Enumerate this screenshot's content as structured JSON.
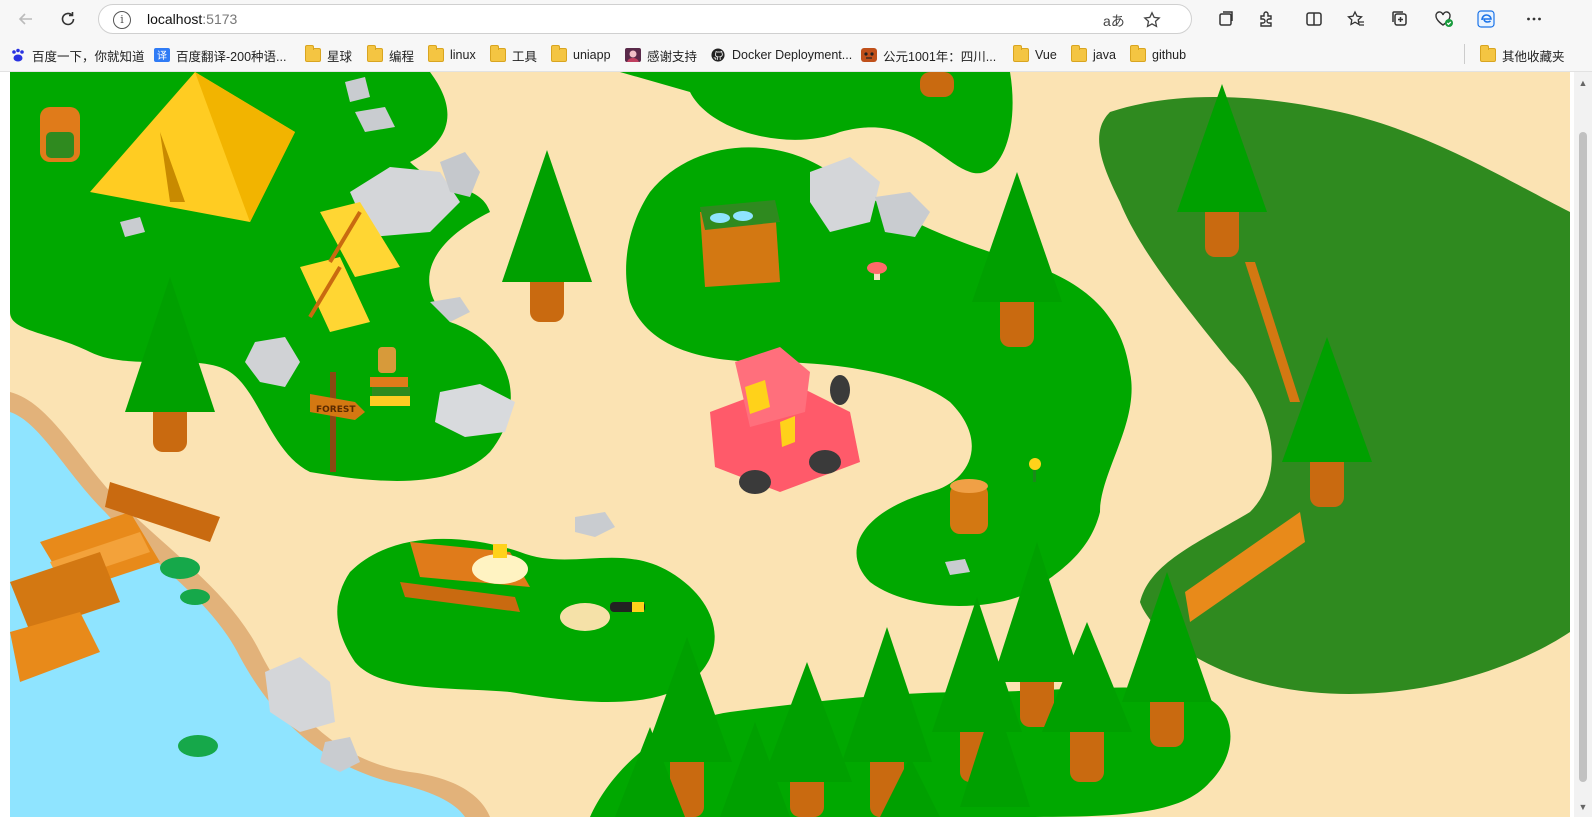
{
  "browser": {
    "nav": {
      "back_icon": "arrow-left-icon",
      "refresh_icon": "refresh-icon"
    },
    "address": {
      "host": "localhost",
      "port": ":5173"
    },
    "right_icons": [
      "read-aloud-icon",
      "favorite-star-icon",
      "tab-actions-icon",
      "extensions-icon",
      "split-screen-icon",
      "favorites-icon",
      "collections-icon",
      "browser-essentials-icon",
      "edge-icon",
      "more-icon"
    ],
    "addr_read_label": "aあ"
  },
  "bookmarks": [
    {
      "label": "百度一下，你就知道",
      "icon": "baidu-paw-icon"
    },
    {
      "label": "百度翻译-200种语...",
      "icon": "translate-icon"
    },
    {
      "label": "星球",
      "icon": "folder-icon"
    },
    {
      "label": "编程",
      "icon": "folder-icon"
    },
    {
      "label": "linux",
      "icon": "folder-icon"
    },
    {
      "label": "工具",
      "icon": "folder-icon"
    },
    {
      "label": "uniapp",
      "icon": "folder-icon"
    },
    {
      "label": "感谢支持",
      "icon": "avatar-icon"
    },
    {
      "label": "Docker Deployment...",
      "icon": "github-icon"
    },
    {
      "label": "公元1001年：四川...",
      "icon": "site-icon"
    },
    {
      "label": "Vue",
      "icon": "folder-icon"
    },
    {
      "label": "java",
      "icon": "folder-icon"
    },
    {
      "label": "github",
      "icon": "folder-icon"
    },
    {
      "label": "其他收藏夹",
      "icon": "folder-icon"
    }
  ],
  "scene": {
    "sign_text": "FOREST",
    "colors": {
      "sand": "#fbe3b3",
      "grass": "#00a800",
      "dark_grass": "#2f8a1f",
      "water": "#8fe4ff",
      "tree": "#00a000",
      "trunk": "#c96a10",
      "car": "#ff5a6a",
      "tent": "#ffcc22"
    }
  }
}
